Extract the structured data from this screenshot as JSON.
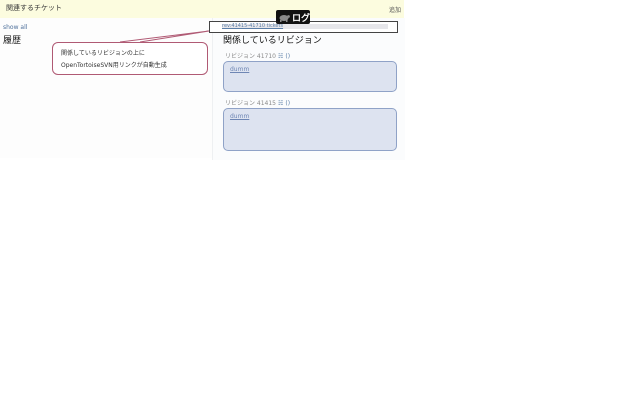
{
  "topbar": {
    "title": "関連するチケット",
    "add_label": "追加"
  },
  "left": {
    "show_all": "show all",
    "history_title": "履歴"
  },
  "log_link": {
    "text": "rev:41415-41710 tickets",
    "badge_label": "ログ"
  },
  "revisions": {
    "title": "関係しているリビジョン",
    "items": [
      {
        "label": "リビジョン 41710",
        "paren": "()",
        "author": "dumm"
      },
      {
        "label": "リビジョン 41415",
        "paren": "()",
        "author": "dumm"
      }
    ]
  },
  "callout": {
    "line1": "関係しているリビジョンの上に",
    "line2": "OpenTortoiseSVN用リンクが自動生成"
  },
  "colors": {
    "accent_border": "#b05a74",
    "rev_box_bg": "#dde3f0",
    "rev_box_border": "#8fa2c7",
    "link": "#5c7fa8"
  }
}
